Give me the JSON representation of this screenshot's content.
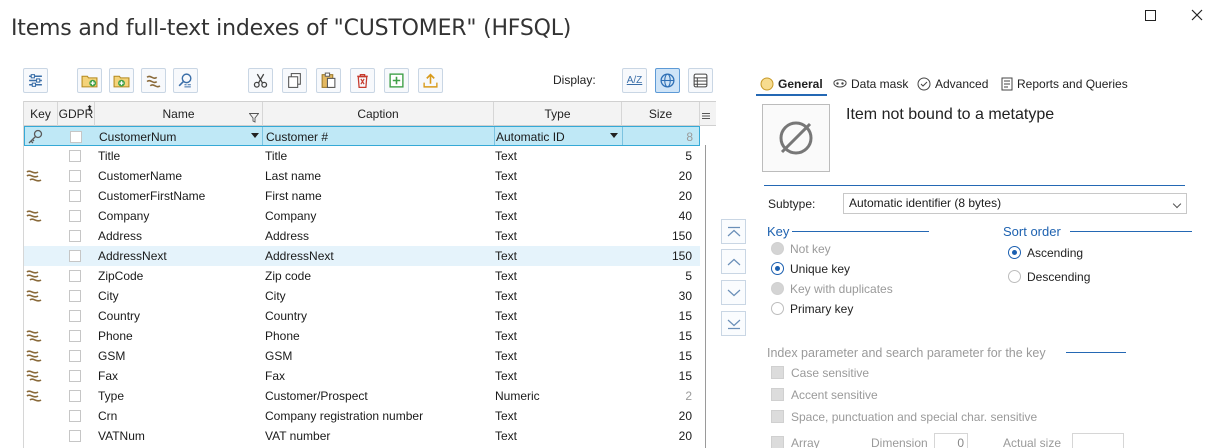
{
  "window": {
    "title": "Items and full-text indexes of \"CUSTOMER\" (HFSQL)"
  },
  "toolbar": {
    "display_label": "Display:",
    "az_label": "A/Z"
  },
  "grid": {
    "columns": [
      "Key",
      "GDPR",
      "Name",
      "Caption",
      "Type",
      "Size"
    ],
    "rows": [
      {
        "key": "primary",
        "name": "CustomerNum",
        "caption": "Customer #",
        "type": "Automatic ID",
        "size": "8",
        "state": "selected",
        "size_dim": true
      },
      {
        "key": "",
        "name": "Title",
        "caption": "Title",
        "type": "Text",
        "size": "5"
      },
      {
        "key": "dup",
        "name": "CustomerName",
        "caption": "Last name",
        "type": "Text",
        "size": "20"
      },
      {
        "key": "",
        "name": "CustomerFirstName",
        "caption": "First name",
        "type": "Text",
        "size": "20"
      },
      {
        "key": "dup",
        "name": "Company",
        "caption": "Company",
        "type": "Text",
        "size": "40"
      },
      {
        "key": "",
        "name": "Address",
        "caption": "Address",
        "type": "Text",
        "size": "150"
      },
      {
        "key": "",
        "name": "AddressNext",
        "caption": "AddressNext",
        "type": "Text",
        "size": "150",
        "state": "hover"
      },
      {
        "key": "dup",
        "name": "ZipCode",
        "caption": "Zip code",
        "type": "Text",
        "size": "5"
      },
      {
        "key": "dup",
        "name": "City",
        "caption": "City",
        "type": "Text",
        "size": "30"
      },
      {
        "key": "",
        "name": "Country",
        "caption": "Country",
        "type": "Text",
        "size": "15"
      },
      {
        "key": "dup",
        "name": "Phone",
        "caption": "Phone",
        "type": "Text",
        "size": "15"
      },
      {
        "key": "dup",
        "name": "GSM",
        "caption": "GSM",
        "type": "Text",
        "size": "15"
      },
      {
        "key": "dup",
        "name": "Fax",
        "caption": "Fax",
        "type": "Text",
        "size": "15"
      },
      {
        "key": "dup",
        "name": "Type",
        "caption": "Customer/Prospect",
        "type": "Numeric",
        "size": "2",
        "size_dim": true
      },
      {
        "key": "",
        "name": "Crn",
        "caption": "Company registration number",
        "type": "Text",
        "size": "20"
      },
      {
        "key": "",
        "name": "VATNum",
        "caption": "VAT number",
        "type": "Text",
        "size": "20"
      }
    ]
  },
  "tabs": [
    "General",
    "Data mask",
    "Advanced",
    "Reports and Queries"
  ],
  "general": {
    "metatype_text": "Item not bound to a metatype",
    "subtype_label": "Subtype:",
    "subtype_value": "Automatic identifier (8 bytes)",
    "key_section": "Key",
    "key_options": [
      "Not key",
      "Unique key",
      "Key with duplicates",
      "Primary key"
    ],
    "sort_section": "Sort order",
    "sort_options": [
      "Ascending",
      "Descending"
    ],
    "index_section": "Index parameter and search parameter for the key",
    "index_options": [
      "Case sensitive",
      "Accent sensitive",
      "Space, punctuation and special char. sensitive"
    ],
    "array_label": "Array",
    "dimension_label": "Dimension",
    "dimension_value": "0",
    "actual_size_label": "Actual size",
    "actual_size_value": ""
  },
  "colors": {
    "accent": "#2468b4",
    "selection": "#bfe8f6",
    "hover": "#e5f3fb"
  }
}
